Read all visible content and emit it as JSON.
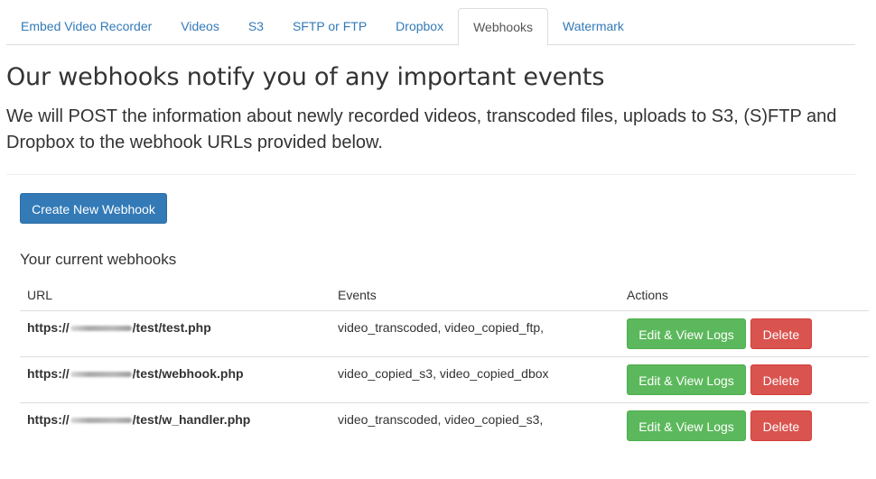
{
  "tabs": [
    {
      "label": "Embed Video Recorder",
      "active": false
    },
    {
      "label": "Videos",
      "active": false
    },
    {
      "label": "S3",
      "active": false
    },
    {
      "label": "SFTP or FTP",
      "active": false
    },
    {
      "label": "Dropbox",
      "active": false
    },
    {
      "label": "Webhooks",
      "active": true
    },
    {
      "label": "Watermark",
      "active": false
    }
  ],
  "header": {
    "title": "Our webhooks notify you of any important events",
    "lead": "We will POST the information about newly recorded videos, transcoded files, uploads to S3, (S)FTP and Dropbox to the webhook URLs provided below."
  },
  "actions": {
    "create_label": "Create New Webhook"
  },
  "webhooks": {
    "title": "Your current webhooks",
    "columns": [
      "URL",
      "Events",
      "Actions"
    ],
    "rows": [
      {
        "url_prefix": "https://",
        "url_suffix": "/test/test.php",
        "events": "video_transcoded, video_copied_ftp,",
        "edit_label": "Edit & View Logs",
        "delete_label": "Delete"
      },
      {
        "url_prefix": "https://",
        "url_suffix": "/test/webhook.php",
        "events": "video_copied_s3, video_copied_dbox",
        "edit_label": "Edit & View Logs",
        "delete_label": "Delete"
      },
      {
        "url_prefix": "https://",
        "url_suffix": "/test/w_handler.php",
        "events": "video_transcoded, video_copied_s3,",
        "edit_label": "Edit & View Logs",
        "delete_label": "Delete"
      }
    ]
  },
  "colors": {
    "primary": "#337ab7",
    "success": "#5cb85c",
    "danger": "#d9534f",
    "link": "#337ab7"
  }
}
